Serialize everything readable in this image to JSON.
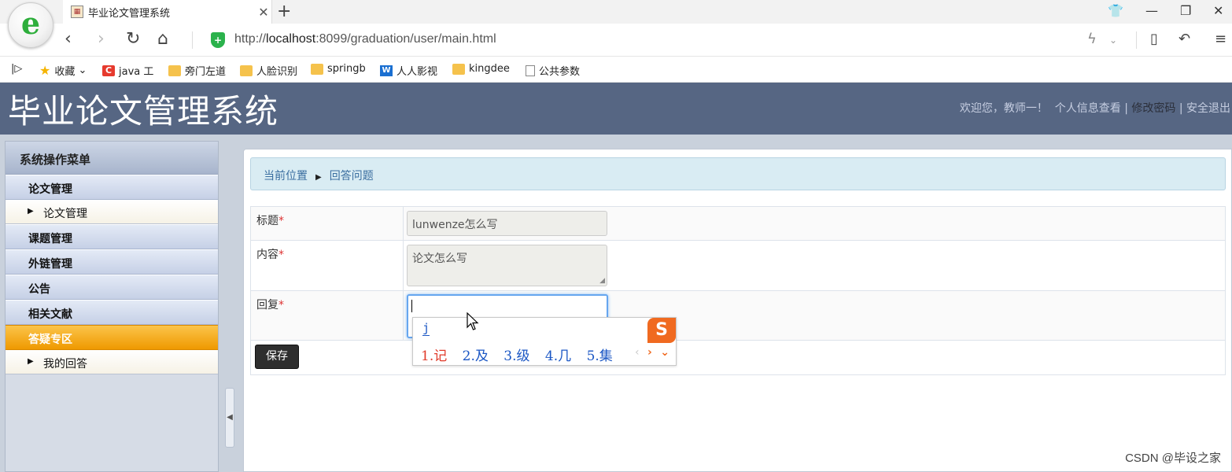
{
  "browser": {
    "tab_title": "毕业论文管理系统",
    "tab_favicon": "document-icon",
    "url_prefix": "http://",
    "url_host": "localhost",
    "url_rest": ":8099/graduation/user/main.html",
    "bookmarks": [
      {
        "label": "收藏",
        "icon": "star-icon"
      },
      {
        "label": "java 工",
        "icon": "c-icon"
      },
      {
        "label": "旁门左道",
        "icon": "folder-icon"
      },
      {
        "label": "人脸识别",
        "icon": "folder-icon"
      },
      {
        "label": "springb",
        "icon": "folder-icon"
      },
      {
        "label": "人人影视",
        "icon": "w-icon"
      },
      {
        "label": "kingdee",
        "icon": "folder-icon"
      },
      {
        "label": "公共参数",
        "icon": "doc-icon"
      }
    ]
  },
  "app": {
    "title": "毕业论文管理系统",
    "welcome": "欢迎您，教师一！",
    "link_profile": "个人信息查看",
    "link_password": "修改密码",
    "link_logout": "安全退出",
    "separator": "|"
  },
  "sidebar": {
    "header": "系统操作菜单",
    "groups": [
      {
        "label": "论文管理",
        "active": false
      },
      {
        "label": "论文管理"
      },
      {
        "label": "课题管理",
        "active": false
      },
      {
        "label": "外链管理",
        "active": false
      },
      {
        "label": "公告",
        "active": false
      },
      {
        "label": "相关文献",
        "active": false
      },
      {
        "label": "答疑专区",
        "active": true
      },
      {
        "label": "我的回答"
      }
    ]
  },
  "main": {
    "breadcrumb_prefix": "当前位置",
    "breadcrumb_current": "回答问题",
    "form": {
      "title_label": "标题",
      "title_value": "lunwenze怎么写",
      "content_label": "内容",
      "content_value": "论文怎么写",
      "reply_label": "回复",
      "reply_value": "",
      "required_mark": "*",
      "save_label": "保存"
    }
  },
  "ime": {
    "composition": "j",
    "logo": "S",
    "candidates": [
      "1.记",
      "2.及",
      "3.级",
      "4.几",
      "5.集"
    ],
    "prev": "‹",
    "next": "›",
    "more": "⌄"
  },
  "watermark": "CSDN @毕设之家",
  "colors": {
    "header_bg": "#566683",
    "active_menu": "#f5a623",
    "breadcrumb_bg": "#d9ecf3",
    "save_button": "#2e2e2e"
  }
}
